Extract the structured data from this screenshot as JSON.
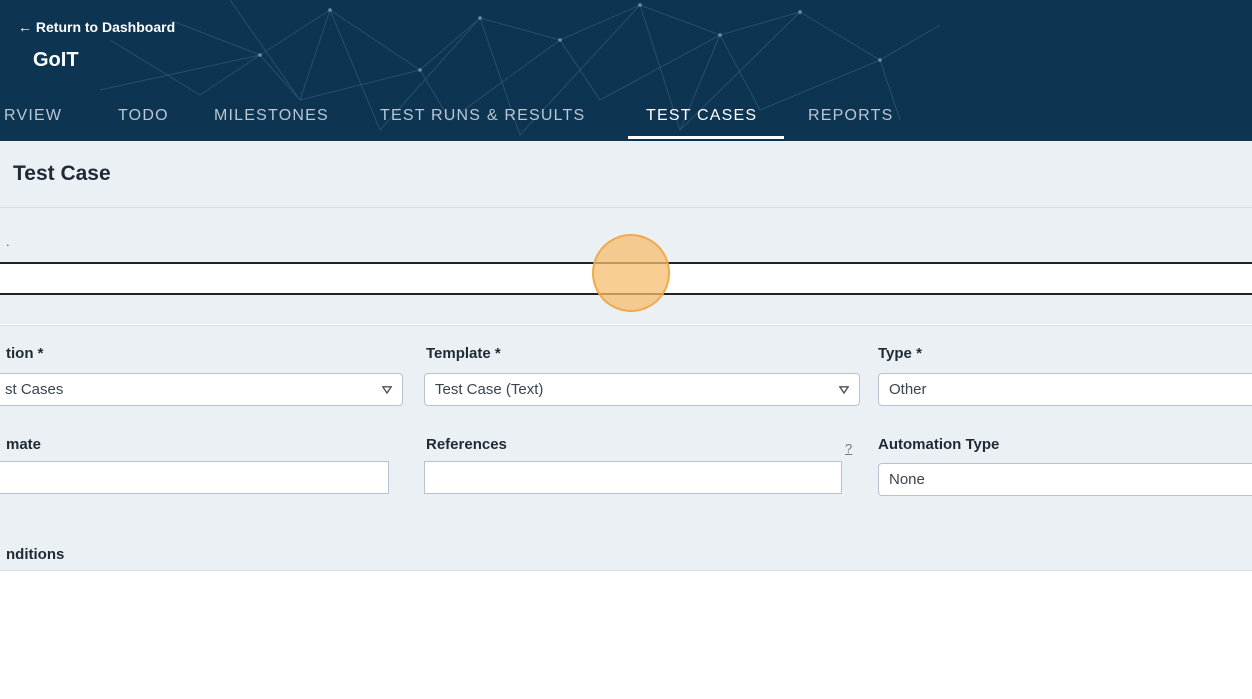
{
  "header": {
    "back_link": "← Return to Dashboard",
    "project_title": "GoIT",
    "tabs": [
      {
        "label": "RVIEW",
        "active": false
      },
      {
        "label": "TODO",
        "active": false
      },
      {
        "label": "MILESTONES",
        "active": false
      },
      {
        "label": "TEST RUNS & RESULTS",
        "active": false
      },
      {
        "label": "TEST CASES",
        "active": true
      },
      {
        "label": "REPORTS",
        "active": false
      }
    ]
  },
  "page": {
    "title": "Test Case"
  },
  "form": {
    "title_value": "",
    "section": {
      "label": "tion *",
      "value": "st Cases"
    },
    "template": {
      "label": "Template *",
      "value": "Test Case (Text)"
    },
    "type": {
      "label": "Type *",
      "value": "Other"
    },
    "estimate": {
      "label": "mate",
      "value": ""
    },
    "references": {
      "label": "References",
      "value": "",
      "help": "?"
    },
    "automation_type": {
      "label": "Automation Type",
      "value": "None"
    },
    "preconditions_label": "nditions"
  },
  "colors": {
    "header_bg": "#0d3451",
    "panel_bg": "#ebf0f5",
    "click_marker": "#f7be6e"
  },
  "icons": {
    "dropdown": "chevron-down-icon"
  }
}
